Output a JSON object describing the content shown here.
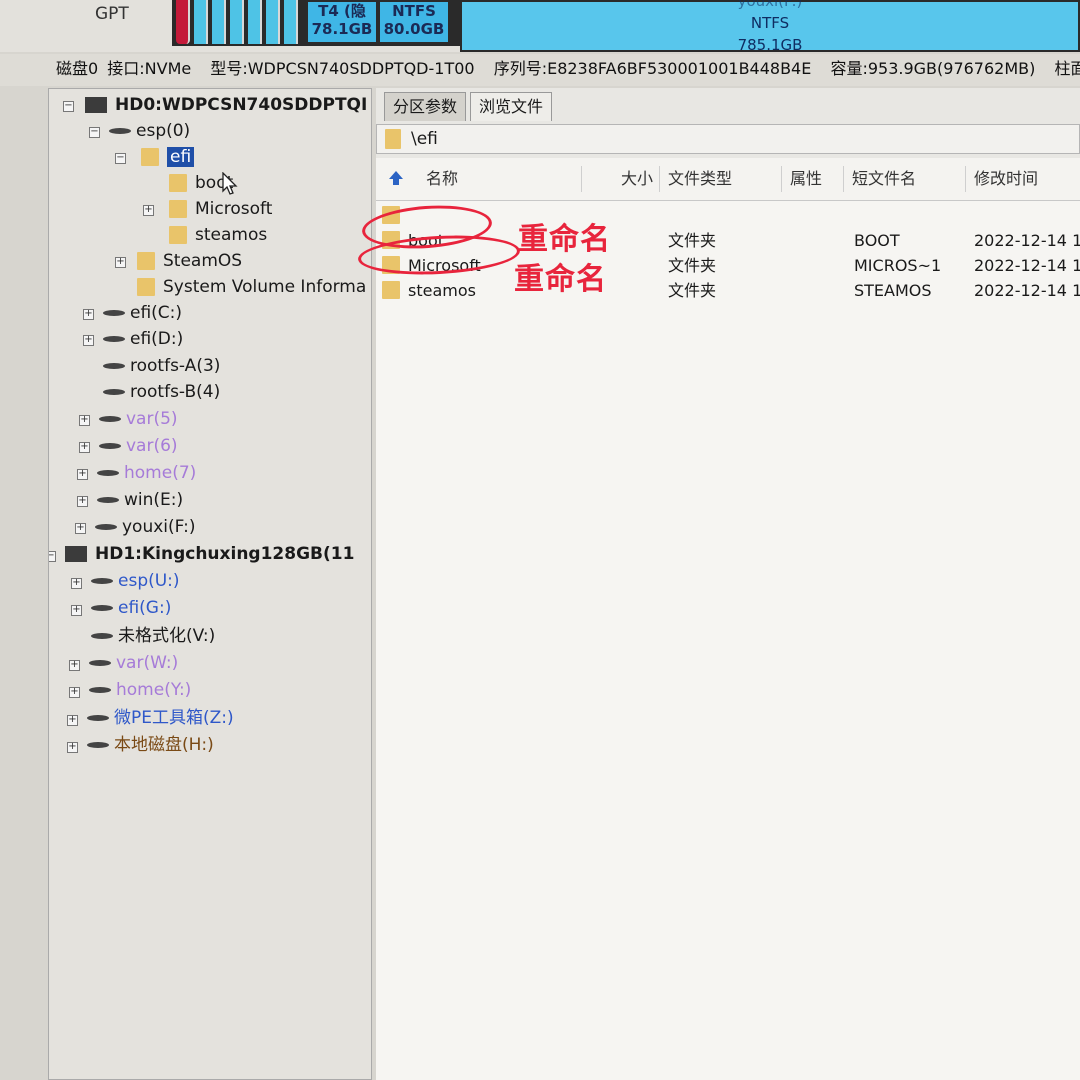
{
  "diskmap": {
    "scheme": "GPT",
    "partitions": [
      {
        "fs": "T4 (隐",
        "size": "78.1GB"
      },
      {
        "fs": "NTFS",
        "size": "80.0GB"
      }
    ],
    "youxi": {
      "name": "youxi(F:)",
      "fs": "NTFS",
      "size": "785.1GB"
    }
  },
  "info": {
    "disk": "磁盘0",
    "interface": "接口:NVMe",
    "model": "型号:WDPCSN740SDDPTQD-1T00",
    "serial": "序列号:E8238FA6BF530001001B448B4E",
    "capacity": "容量:953.9GB(976762MB)",
    "cyl": "柱面"
  },
  "tree": {
    "hd0": "HD0:WDPCSN740SDDPTQI",
    "esp0": "esp(0)",
    "efi": "efi",
    "boot": "boot",
    "microsoft": "Microsoft",
    "steamos_lower": "steamos",
    "steamos": "SteamOS",
    "svi": "System Volume Informa",
    "efi_c": "efi(C:)",
    "efi_d": "efi(D:)",
    "rootfs_a": "rootfs-A(3)",
    "rootfs_b": "rootfs-B(4)",
    "var5": "var(5)",
    "var6": "var(6)",
    "home7": "home(7)",
    "win_e": "win(E:)",
    "youxi_f": "youxi(F:)",
    "hd1": "HD1:Kingchuxing128GB(11",
    "esp_u": "esp(U:)",
    "efi_g": "efi(G:)",
    "unformatted": "未格式化(V:)",
    "var_w": "var(W:)",
    "home_y": "home(Y:)",
    "wepe": "微PE工具箱(Z:)",
    "local_h": "本地磁盘(H:)"
  },
  "tabs": {
    "params": "分区参数",
    "browse": "浏览文件"
  },
  "path": "\\efi",
  "columns": {
    "name": "名称",
    "size": "大小",
    "type": "文件类型",
    "attr": "属性",
    "short": "短文件名",
    "mtime": "修改时间"
  },
  "files": [
    {
      "name": "boot",
      "type": "文件夹",
      "short": "BOOT",
      "mtime": "2022-12-14 1"
    },
    {
      "name": "Microsoft",
      "type": "文件夹",
      "short": "MICROS~1",
      "mtime": "2022-12-14 1"
    },
    {
      "name": "steamos",
      "type": "文件夹",
      "short": "STEAMOS",
      "mtime": "2022-12-14 1"
    }
  ],
  "annotations": {
    "rename1": "重命名",
    "rename2": "重命名"
  },
  "colors": {
    "annotation": "#e8243c",
    "selection": "#1f4fa8",
    "partition": "#3fb6e6"
  }
}
